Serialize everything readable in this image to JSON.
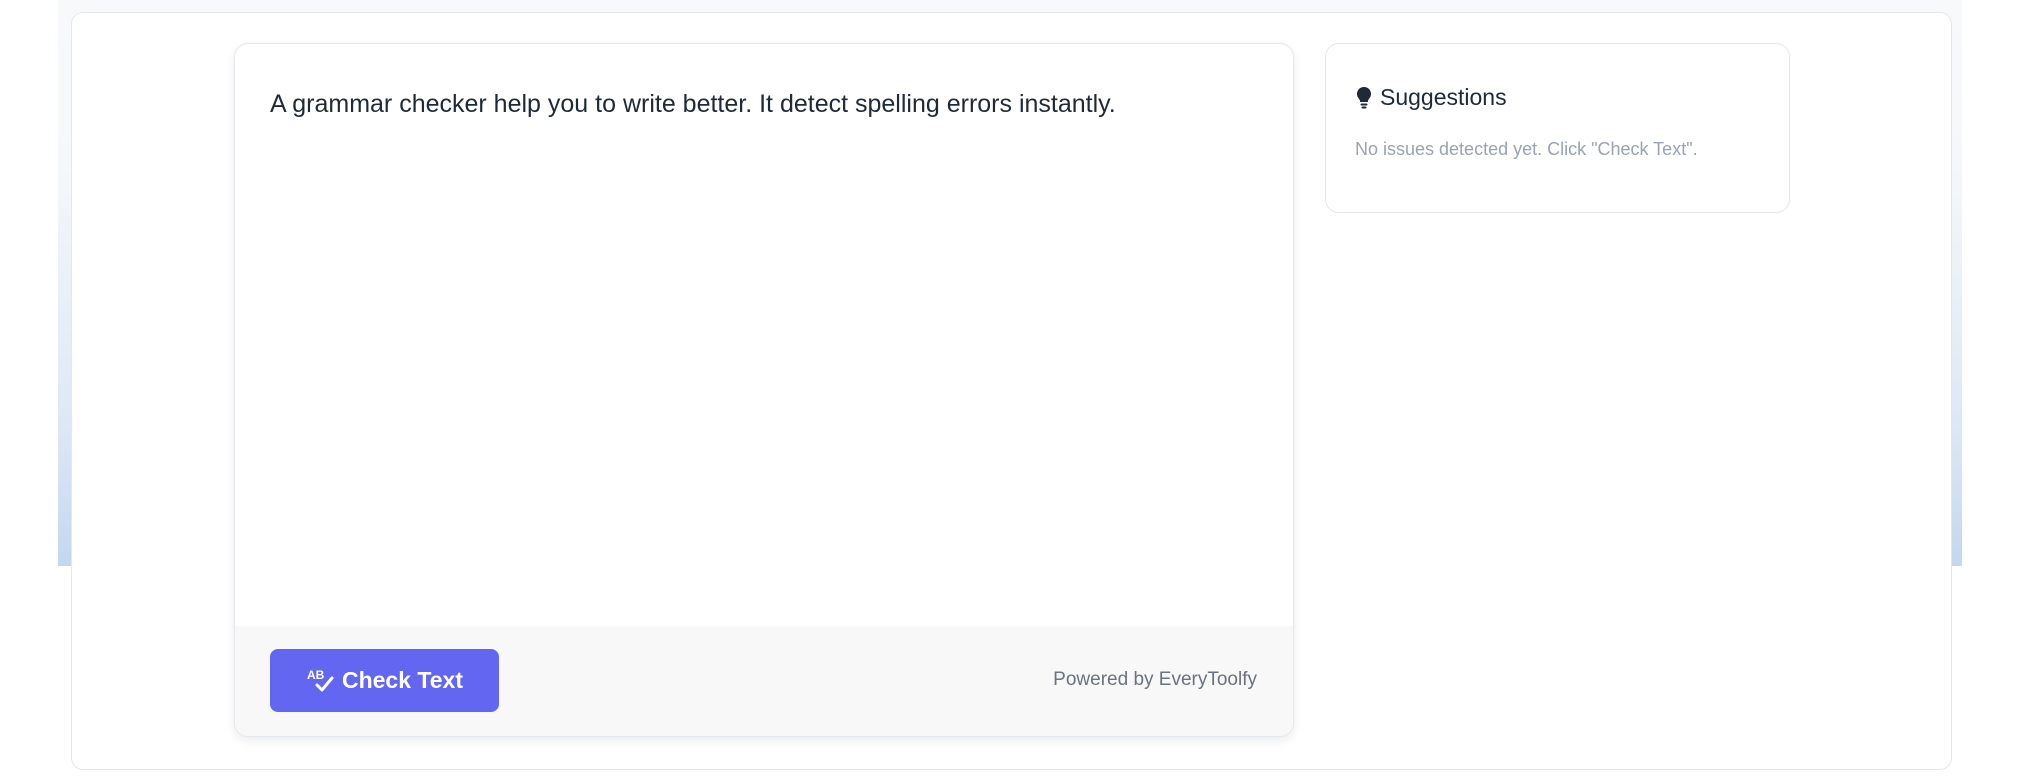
{
  "editor": {
    "text": "A grammar checker help you to write better. It detect spelling errors instantly.",
    "check_button_label": "Check Text",
    "check_button_icon": "spellcheck-icon",
    "powered_by": "Powered by EveryToolfy"
  },
  "suggestions": {
    "title": "Suggestions",
    "title_icon": "lightbulb-icon",
    "empty_message": "No issues detected yet. Click \"Check Text\"."
  },
  "colors": {
    "accent": "#6366f1",
    "text_primary": "#1f2937",
    "text_muted": "#9aa3b2"
  }
}
